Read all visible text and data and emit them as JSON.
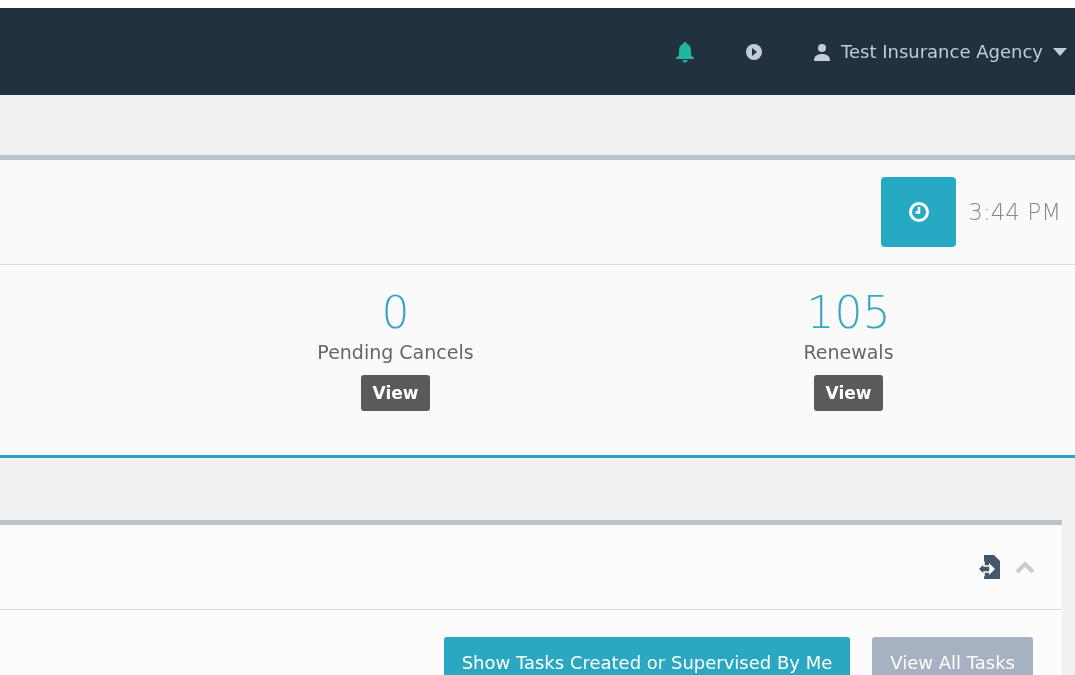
{
  "navbar": {
    "user": {
      "name": "Test Insurance Agency"
    }
  },
  "clock": {
    "time": "3:44 PM"
  },
  "stats": [
    {
      "value": "0",
      "label": "Pending Cancels",
      "button": "View"
    },
    {
      "value": "105",
      "label": "Renewals",
      "button": "View"
    }
  ],
  "tasks_panel": {
    "buttons": [
      {
        "label": "Show Tasks Created or Supervised By Me",
        "kind": "primary"
      },
      {
        "label": "View All Tasks",
        "kind": "secondary"
      }
    ]
  }
}
